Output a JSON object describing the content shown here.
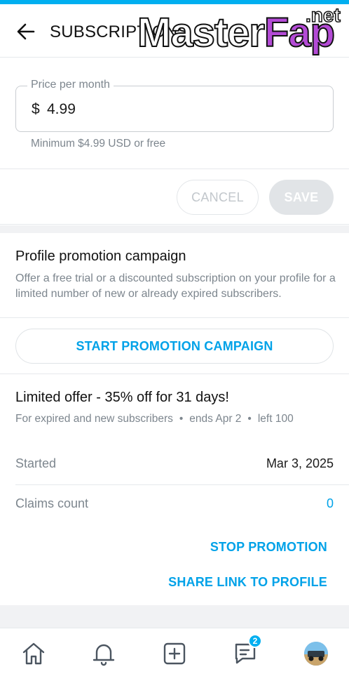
{
  "header": {
    "title": "SUBSCRIPTIONS",
    "watermark_main": "Master",
    "watermark_accent": "Fap",
    "watermark_tld": ".net"
  },
  "price": {
    "label": "Price per month",
    "currency": "$",
    "value": "4.99",
    "hint": "Minimum $4.99 USD or free"
  },
  "actions": {
    "cancel_label": "CANCEL",
    "save_label": "SAVE"
  },
  "promotion": {
    "title": "Profile promotion campaign",
    "description": "Offer a free trial or a discounted subscription on your profile for a limited number of new or already expired subscribers.",
    "start_label": "START PROMOTION CAMPAIGN"
  },
  "offer": {
    "title": "Limited offer - 35% off for 31 days!",
    "audience": "For expired and new subscribers",
    "ends": "ends Apr 2",
    "left": "left 100",
    "started_label": "Started",
    "started_value": "Mar 3, 2025",
    "claims_label": "Claims count",
    "claims_value": "0",
    "stop_label": "STOP PROMOTION",
    "share_label": "SHARE LINK TO PROFILE"
  },
  "nav": {
    "items": [
      {
        "icon": "home-icon"
      },
      {
        "icon": "bell-icon"
      },
      {
        "icon": "add-post-icon"
      },
      {
        "icon": "messages-icon",
        "badge": "2"
      },
      {
        "icon": "avatar"
      }
    ]
  },
  "colors": {
    "accent": "#00aff0",
    "link": "#00a2e8",
    "muted": "#7d868e"
  }
}
